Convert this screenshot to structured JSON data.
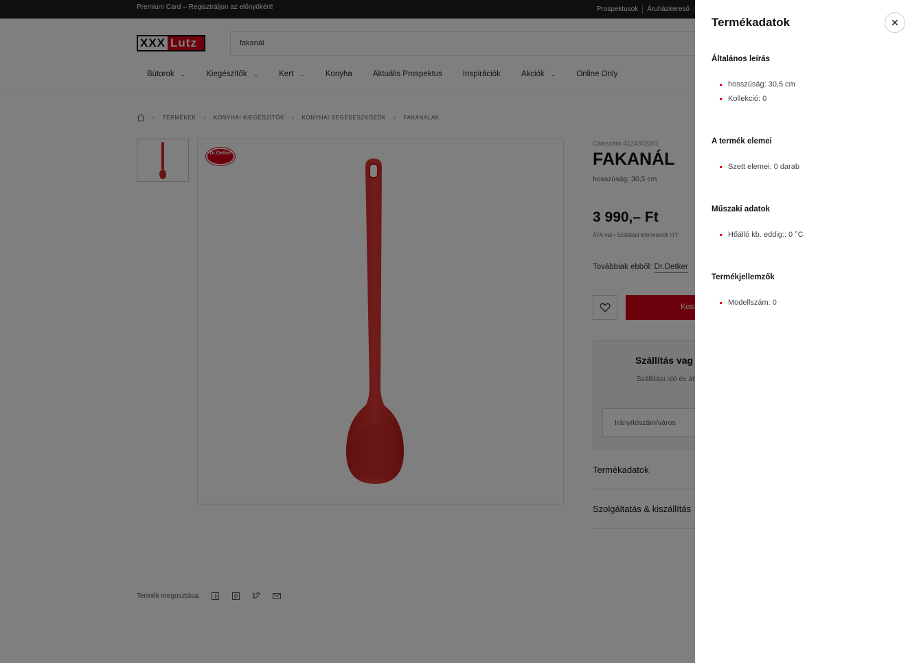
{
  "topbar": {
    "promo": "Premium Card – Regisztráljon az előnyökért!",
    "links": [
      "Prospektusok",
      "Áruházkereső"
    ]
  },
  "header": {
    "logo_xxx": "XXX",
    "logo_lutz": "Lutz",
    "search_value": "fakanál",
    "nav": [
      {
        "label": "Bútorok",
        "dropdown": true
      },
      {
        "label": "Kiegészítők",
        "dropdown": true
      },
      {
        "label": "Kert",
        "dropdown": true
      },
      {
        "label": "Konyha",
        "dropdown": false
      },
      {
        "label": "Aktuális Prospektus",
        "dropdown": false
      },
      {
        "label": "Inspirációk",
        "dropdown": false
      },
      {
        "label": "Akciók",
        "dropdown": true
      },
      {
        "label": "Online Only",
        "dropdown": false
      }
    ]
  },
  "breadcrumb": [
    "TERMÉKEK",
    "KONYHAI KIEGÉSZÍTŐK",
    "KONYHAI SEGÉDESZKÖZÖK",
    "FAKANALAK"
  ],
  "gallery": {
    "brand_badge": "Dr.Oetker"
  },
  "product": {
    "sku": "Cikkszám 4124302301",
    "title": "FAKANÁL",
    "subtitle": "hosszúság: 30,5 cm",
    "price": "3 990,– Ft",
    "vat_info": "ÁFA-val • Szállítási információk ITT",
    "more_from_label": "Továbbiak ebből:",
    "more_from_brand": "Dr.Oetker",
    "cart_label": "Kosá",
    "shipping_title": "Szállítás vag",
    "shipping_text": "Szállítási idő és átvé megjelenít",
    "shipping_input_placeholder": "Irányítószám/város",
    "accordion": [
      "Termékadatok",
      "Szolgáltatás & kiszállítás"
    ]
  },
  "share": {
    "label": "Termék megosztása:",
    "icons": [
      "facebook-icon",
      "pinterest-icon",
      "twitter-icon",
      "mail-icon"
    ]
  },
  "drawer": {
    "title": "Termékadatok",
    "sections": [
      {
        "heading": "Általános leírás",
        "items": [
          "hosszúság: 30,5 cm",
          "Kollekció: 0"
        ]
      },
      {
        "heading": "A termék elemei",
        "items": [
          "Szett elemei: 0 darab"
        ]
      },
      {
        "heading": "Műszaki adatok",
        "items": [
          "Hőálló kb. eddig:: 0 °C"
        ]
      },
      {
        "heading": "Termékjellemzők",
        "items": [
          "Modellszám: 0"
        ]
      }
    ]
  },
  "colors": {
    "accent": "#d9001b",
    "topbar": "#1e1e1e",
    "spoon": "#d42a2a"
  }
}
